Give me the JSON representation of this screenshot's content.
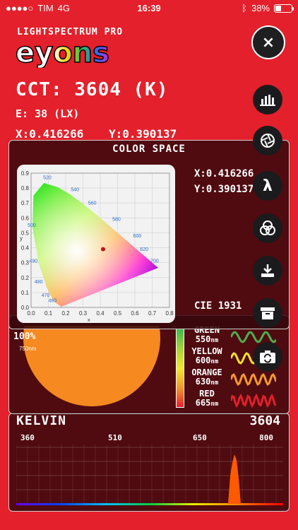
{
  "status": {
    "carrier": "TIM",
    "network": "4G",
    "time": "16:39",
    "battery": "38%",
    "battery_level": 0.38
  },
  "brand": "LIGHTSPECTRUM PRO",
  "logo_text": "eyons",
  "close_label": "×",
  "reading": {
    "cct": "CCT: 3604 (K)",
    "lux": "E: 38 (LX)",
    "x": "X:0.416266",
    "y": "Y:0.390137"
  },
  "color_space": {
    "title": "COLOR SPACE",
    "x": "X:0.416266",
    "y": "Y:0.390137",
    "label": "CIE 1931",
    "x_ticks": [
      "0.0",
      "0.1",
      "0.2",
      "0.3",
      "0.4",
      "0.5",
      "0.6",
      "0.7",
      "0.8"
    ],
    "y_ticks": [
      "0.9",
      "0.8",
      "0.7",
      "0.6",
      "0.5",
      "0.4",
      "0.3",
      "0.2",
      "0.1",
      "0.0"
    ],
    "x_axis": "x",
    "y_axis": "y",
    "wavelengths": [
      "520",
      "540",
      "560",
      "580",
      "600",
      "620",
      "700",
      "500",
      "490",
      "480",
      "470",
      "460"
    ],
    "point": {
      "x": 0.4163,
      "y": 0.3901
    }
  },
  "color_scale": {
    "percent": "100%",
    "nm": "750nm",
    "items": [
      {
        "name": "GREEN",
        "nm": "550",
        "unit": "nm",
        "color": "#4caf50"
      },
      {
        "name": "YELLOW",
        "nm": "600",
        "unit": "nm",
        "color": "#f6e32b"
      },
      {
        "name": "ORANGE",
        "nm": "630",
        "unit": "nm",
        "color": "#f59a2a"
      },
      {
        "name": "RED",
        "nm": "665",
        "unit": "nm",
        "color": "#e3202b"
      }
    ]
  },
  "spectrum": {
    "title": "KELVIN",
    "value": "3604",
    "ticks": [
      "360",
      "510",
      "650",
      "800"
    ]
  },
  "actions": [
    "chart-icon",
    "aperture-icon",
    "lambda-icon",
    "color-circles-icon",
    "download-icon",
    "archive-icon",
    "camera-switch-icon"
  ]
}
